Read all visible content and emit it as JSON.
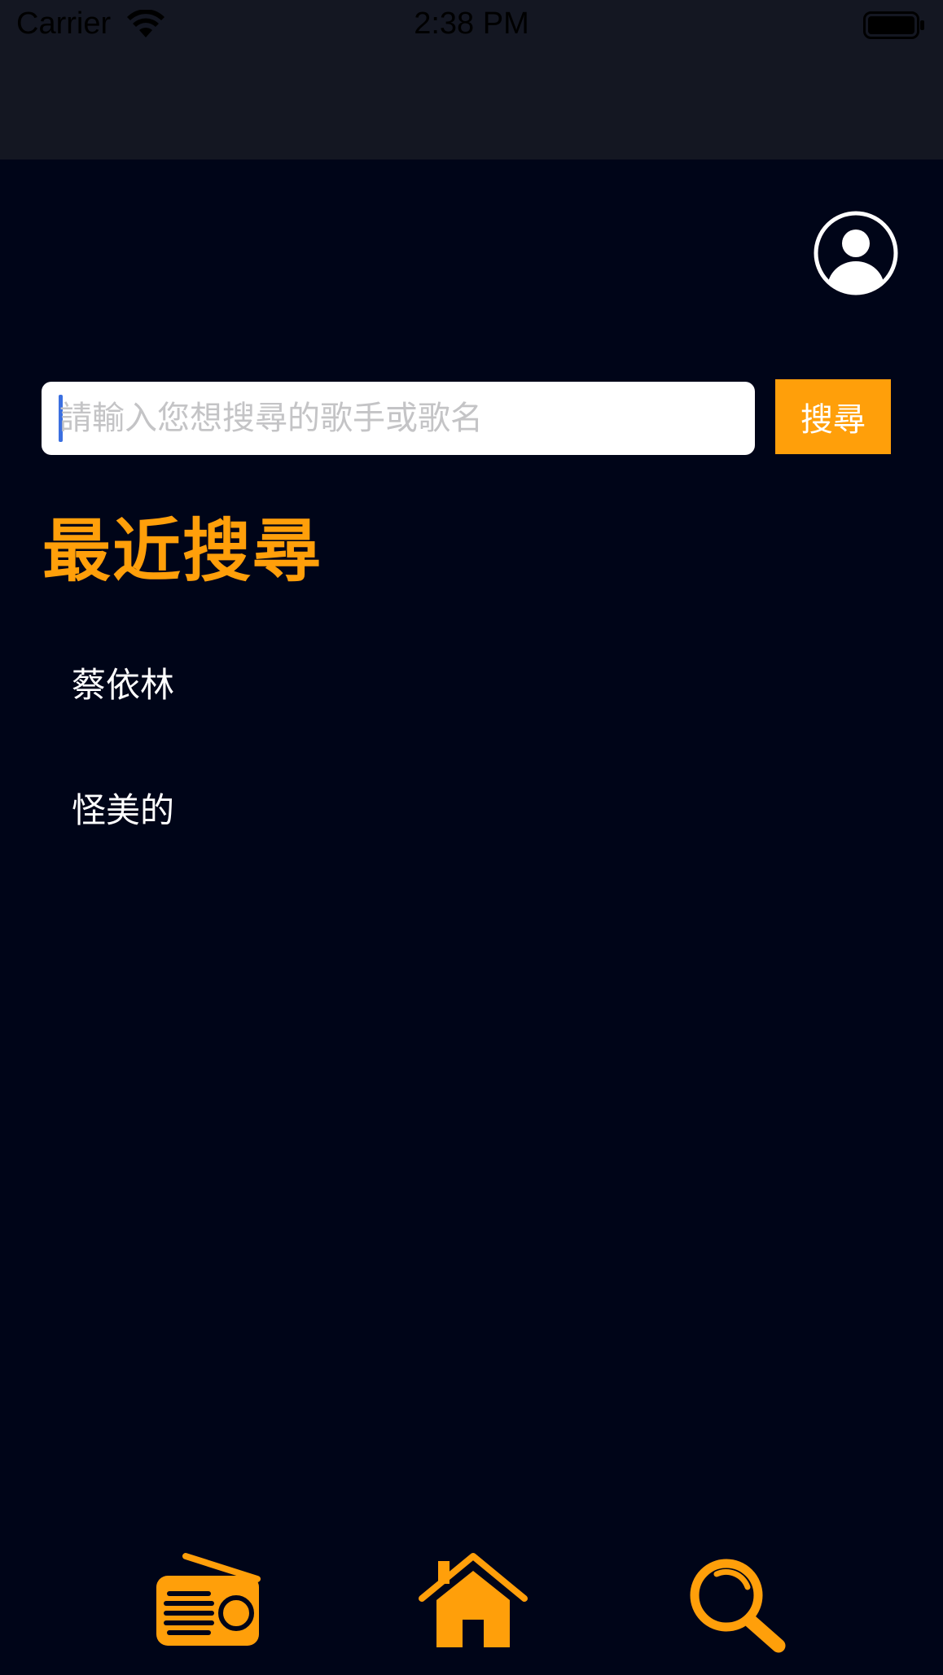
{
  "status_bar": {
    "carrier": "Carrier",
    "time": "2:38 PM",
    "wifi_icon": "wifi-icon",
    "battery_icon": "battery-icon"
  },
  "profile": {
    "icon": "user-circle-icon"
  },
  "search": {
    "placeholder": "請輸入您想搜尋的歌手或歌名",
    "value": "",
    "button_label": "搜尋"
  },
  "recent": {
    "title": "最近搜尋",
    "items": [
      "蔡依林",
      "怪美的"
    ]
  },
  "tab_bar": {
    "items": [
      {
        "icon": "radio-icon"
      },
      {
        "icon": "home-icon"
      },
      {
        "icon": "search-icon"
      }
    ]
  },
  "colors": {
    "background": "#000518",
    "nav_background": "#141722",
    "accent": "#ff9f0a",
    "text": "#ffffff",
    "cursor": "#3b6fe0"
  }
}
